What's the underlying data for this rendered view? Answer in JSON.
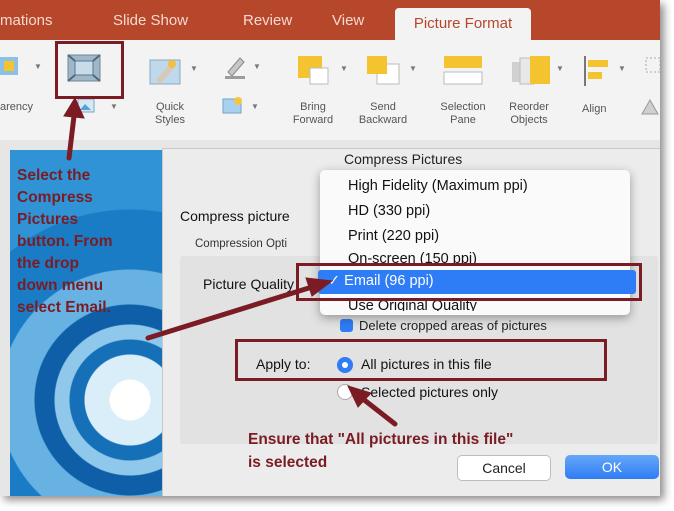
{
  "tabs": {
    "items": [
      "mations",
      "Slide Show",
      "Review",
      "View"
    ],
    "active": "Picture Format"
  },
  "ribbon": {
    "transparency_label": "arency",
    "quick_styles": [
      "Quick",
      "Styles"
    ],
    "bring_forward": [
      "Bring",
      "Forward"
    ],
    "send_backward": [
      "Send",
      "Backward"
    ],
    "selection_pane": [
      "Selection",
      "Pane"
    ],
    "reorder_objects": [
      "Reorder",
      "Objects"
    ],
    "align": "Align"
  },
  "dialog": {
    "title": "Compress Pictures",
    "compress_pictures_label": "Compress picture",
    "compression_options_label": "Compression Opti",
    "picture_quality_label": "Picture Quality",
    "quality_options": [
      "High Fidelity (Maximum ppi)",
      "HD (330 ppi)",
      "Print (220 ppi)",
      "On-screen (150 ppi)",
      "Email (96 ppi)",
      "Use Original Quality"
    ],
    "selected_quality": "✓ Email (96 ppi)",
    "delete_cropped_label": "Delete cropped areas of pictures",
    "apply_to_label": "Apply to:",
    "apply_all": "All pictures in this file",
    "apply_selected": "Selected pictures only",
    "cancel_label": "Cancel",
    "ok_label": "OK"
  },
  "annotations": {
    "left_lines": [
      "Select the",
      "Compress",
      "Pictures",
      "button. From",
      "the drop",
      "down menu",
      "select Email."
    ],
    "bottom_lines": [
      "Ensure that \"All pictures in this file\"",
      "is selected"
    ]
  },
  "colors": {
    "tab_bar": "#b7472a",
    "annotation": "#7b1c24",
    "selection_blue": "#2e7cf6"
  }
}
